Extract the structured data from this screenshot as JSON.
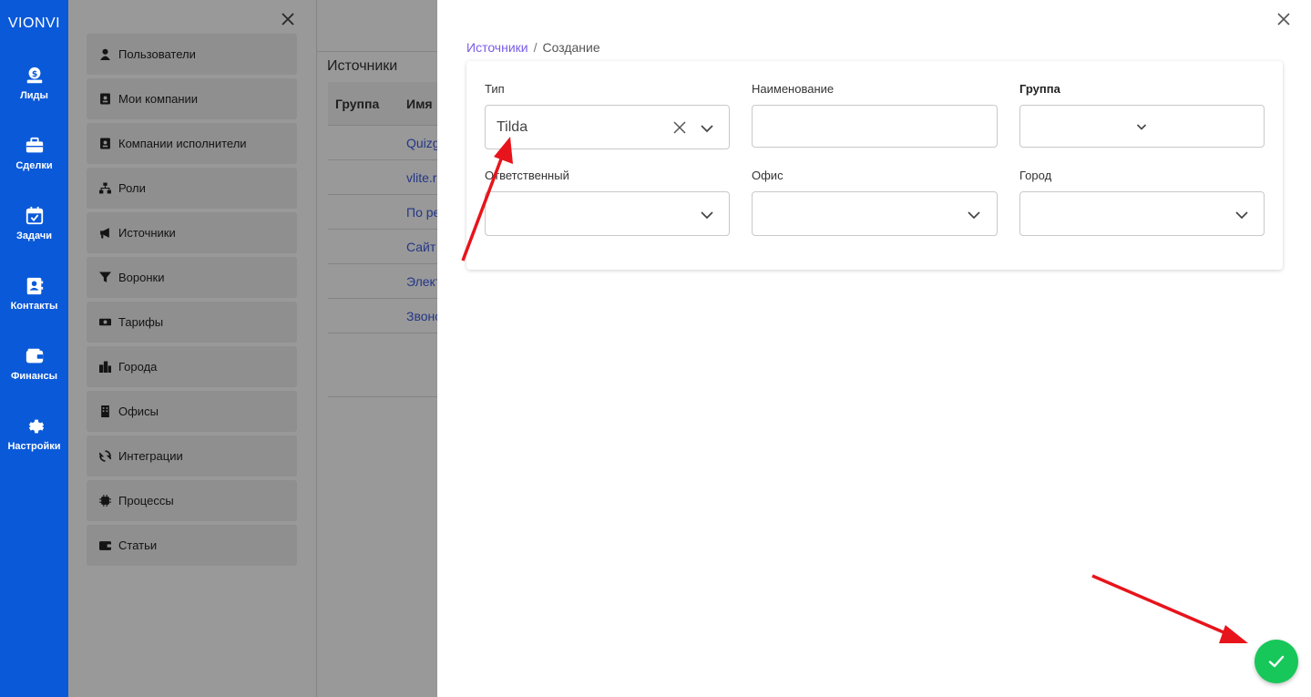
{
  "rail": {
    "brand": "VIONVI",
    "items": [
      {
        "label": "Лиды",
        "icon": "money-bag-icon"
      },
      {
        "label": "Сделки",
        "icon": "briefcase-icon"
      },
      {
        "label": "Задачи",
        "icon": "calendar-check-icon"
      },
      {
        "label": "Контакты",
        "icon": "contact-book-icon"
      },
      {
        "label": "Финансы",
        "icon": "wallet-icon"
      },
      {
        "label": "Настройки",
        "icon": "gear-icon"
      }
    ]
  },
  "settings_menu": {
    "items": [
      {
        "label": "Пользователи",
        "icon": "user-icon"
      },
      {
        "label": "Мои компании",
        "icon": "id-card-icon"
      },
      {
        "label": "Компании исполнители",
        "icon": "id-card-icon"
      },
      {
        "label": "Роли",
        "icon": "sitemap-icon"
      },
      {
        "label": "Источники",
        "icon": "bullhorn-icon"
      },
      {
        "label": "Воронки",
        "icon": "funnel-icon"
      },
      {
        "label": "Тарифы",
        "icon": "money-bill-icon"
      },
      {
        "label": "Города",
        "icon": "city-icon"
      },
      {
        "label": "Офисы",
        "icon": "building-icon"
      },
      {
        "label": "Интеграции",
        "icon": "sync-icon"
      },
      {
        "label": "Процессы",
        "icon": "chip-icon"
      },
      {
        "label": "Статьи",
        "icon": "wallet-icon"
      }
    ]
  },
  "sources_list": {
    "title": "Источники",
    "columns": [
      "Группа",
      "Имя"
    ],
    "rows": [
      "Quizg",
      "vlite.r",
      "По ре",
      "Сайт",
      "Элект",
      "Звоно"
    ]
  },
  "modal": {
    "breadcrumb": {
      "parent": "Источники",
      "separator": "/",
      "current": "Создание"
    },
    "fields": {
      "type": {
        "label": "Тип",
        "value": "Tilda"
      },
      "name": {
        "label": "Наименование",
        "value": ""
      },
      "group": {
        "label": "Группа",
        "value": ""
      },
      "responsible": {
        "label": "Ответственный",
        "value": ""
      },
      "office": {
        "label": "Офис",
        "value": ""
      },
      "city": {
        "label": "Город",
        "value": ""
      }
    }
  },
  "colors": {
    "rail": "#0a59d9",
    "link": "#7a5ce6",
    "save": "#18c75a",
    "annotation_arrow": "#e8141b"
  }
}
